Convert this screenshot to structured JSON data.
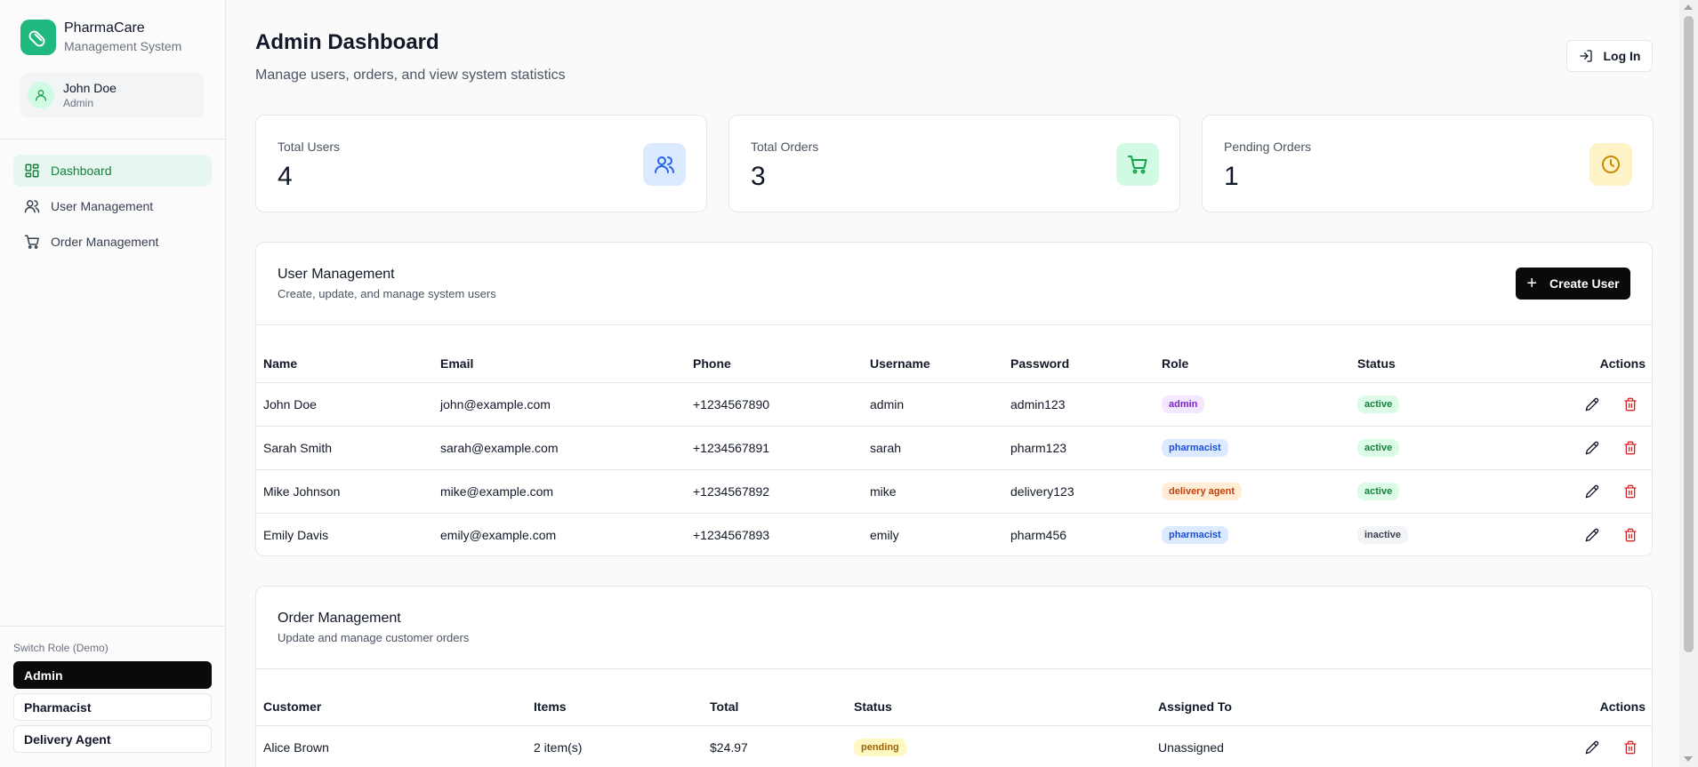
{
  "brand": {
    "name": "PharmaCare",
    "subtitle": "Management System"
  },
  "user": {
    "name": "John Doe",
    "role": "Admin"
  },
  "nav": [
    {
      "label": "Dashboard",
      "icon": "dashboard-icon"
    },
    {
      "label": "User Management",
      "icon": "users-icon"
    },
    {
      "label": "Order Management",
      "icon": "cart-icon"
    }
  ],
  "switch_role": {
    "label": "Switch Role (Demo)",
    "options": [
      "Admin",
      "Pharmacist",
      "Delivery Agent"
    ],
    "selected": "Admin"
  },
  "header": {
    "title": "Admin Dashboard",
    "subtitle": "Manage users, orders, and view system statistics",
    "login_label": "Log In"
  },
  "stats": [
    {
      "label": "Total Users",
      "value": "4",
      "icon": "users-icon",
      "color": "#dbeafe",
      "icon_color": "#2563eb"
    },
    {
      "label": "Total Orders",
      "value": "3",
      "icon": "cart-icon",
      "color": "#d1fae5",
      "icon_color": "#16a34a"
    },
    {
      "label": "Pending Orders",
      "value": "1",
      "icon": "clock-icon",
      "color": "#fef3c7",
      "icon_color": "#ca8a04"
    }
  ],
  "user_management": {
    "title": "User Management",
    "subtitle": "Create, update, and manage system users",
    "create_label": "Create User",
    "columns": [
      "Name",
      "Email",
      "Phone",
      "Username",
      "Password",
      "Role",
      "Status",
      "Actions"
    ],
    "rows": [
      {
        "name": "John Doe",
        "email": "john@example.com",
        "phone": "+1234567890",
        "username": "admin",
        "password": "admin123",
        "role": "admin",
        "status": "active"
      },
      {
        "name": "Sarah Smith",
        "email": "sarah@example.com",
        "phone": "+1234567891",
        "username": "sarah",
        "password": "pharm123",
        "role": "pharmacist",
        "status": "active"
      },
      {
        "name": "Mike Johnson",
        "email": "mike@example.com",
        "phone": "+1234567892",
        "username": "mike",
        "password": "delivery123",
        "role": "delivery agent",
        "status": "active"
      },
      {
        "name": "Emily Davis",
        "email": "emily@example.com",
        "phone": "+1234567893",
        "username": "emily",
        "password": "pharm456",
        "role": "pharmacist",
        "status": "inactive"
      }
    ]
  },
  "order_management": {
    "title": "Order Management",
    "subtitle": "Update and manage customer orders",
    "columns": [
      "Customer",
      "Items",
      "Total",
      "Status",
      "Assigned To",
      "Actions"
    ],
    "rows": [
      {
        "customer": "Alice Brown",
        "items": "2 item(s)",
        "total": "$24.97",
        "status": "pending",
        "assigned": "Unassigned"
      }
    ]
  },
  "colors": {
    "brand": "#1fb87e",
    "role_admin_bg": "#f3e8ff",
    "role_admin_fg": "#7e22ce",
    "role_pharmacist_bg": "#dbeafe",
    "role_pharmacist_fg": "#1d4ed8",
    "role_delivery_bg": "#ffedd5",
    "role_delivery_fg": "#c2410c",
    "status_active_bg": "#dcfce7",
    "status_active_fg": "#15803d",
    "status_inactive_bg": "#f3f4f6",
    "status_inactive_fg": "#374151",
    "status_pending_bg": "#fef9c3",
    "status_pending_fg": "#a16207",
    "delete_icon": "#dc2626"
  }
}
